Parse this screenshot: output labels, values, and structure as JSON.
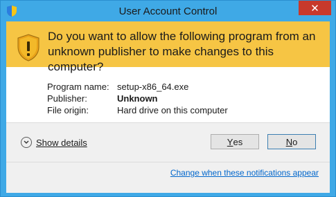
{
  "window": {
    "title": "User Account Control",
    "close_label": "✕"
  },
  "banner": {
    "question": "Do you want to allow the following program from an unknown publisher to make changes to this computer?"
  },
  "details": {
    "rows": [
      {
        "label": "Program name:",
        "value": "setup-x86_64.exe"
      },
      {
        "label": "Publisher:",
        "value": "Unknown"
      },
      {
        "label": "File origin:",
        "value": "Hard drive on this computer"
      }
    ]
  },
  "footer": {
    "show_details_label": "Show details",
    "yes_label": "Yes",
    "yes_mnemonic": "Y",
    "no_label": "No",
    "no_mnemonic": "N",
    "notifications_link": "Change when these notifications appear"
  },
  "icons": {
    "app": "uac-shield-icon",
    "banner": "warning-shield-icon",
    "details": "chevron-down-icon"
  },
  "colors": {
    "frame": "#3fa9e6",
    "banner": "#f6c544",
    "close": "#c7392b",
    "link": "#0066cc"
  }
}
